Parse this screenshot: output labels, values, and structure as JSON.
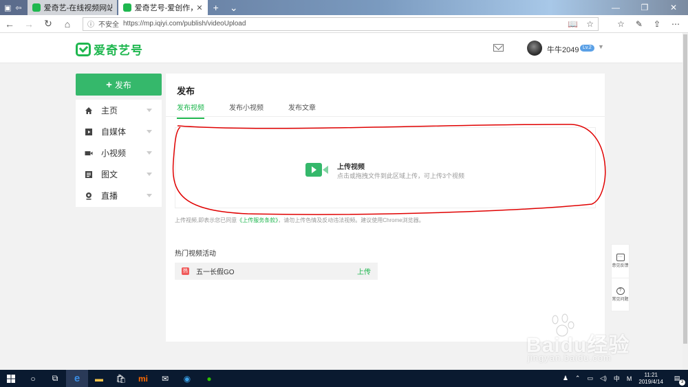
{
  "browser": {
    "tabs": [
      {
        "title": "爱奇艺-在线视频网站-海量正"
      },
      {
        "title": "爱奇艺号-爱创作，爱奇"
      }
    ],
    "new_tab_icon": "plus-icon",
    "address": {
      "security_label": "不安全",
      "url": "https://mp.iqiyi.com/publish/videoUpload"
    }
  },
  "site": {
    "logo_text": "爱奇艺号",
    "username": "牛牛2049",
    "level": "Lv.2"
  },
  "sidebar": {
    "publish_label": "发布",
    "items": [
      {
        "label": "主页",
        "icon": "home-icon"
      },
      {
        "label": "自媒体",
        "icon": "media-icon"
      },
      {
        "label": "小视频",
        "icon": "camera-icon"
      },
      {
        "label": "图文",
        "icon": "article-icon"
      },
      {
        "label": "直播",
        "icon": "live-icon"
      }
    ]
  },
  "main": {
    "title": "发布",
    "tabs": [
      {
        "label": "发布视频",
        "active": true
      },
      {
        "label": "发布小视频",
        "active": false
      },
      {
        "label": "发布文章",
        "active": false
      }
    ],
    "upload": {
      "title": "上传视频",
      "desc": "点击或拖拽文件到此区域上传，可上传3个视频"
    },
    "notice": {
      "before": "上传视频,即表示您已同意",
      "link": "《上传服务条款》",
      "after": "，请勿上传色情及反动违法视频。建议使用Chrome浏览器。"
    },
    "hot": {
      "title": "热门视频活动",
      "items": [
        {
          "badge": "热",
          "name": "五一长假GO",
          "action": "上传"
        }
      ]
    }
  },
  "float": {
    "feedback": "意见反馈",
    "faq": "常见问题"
  },
  "watermark": {
    "text": "Baidu经验",
    "sub": "jingyan.baidu.com"
  },
  "taskbar": {
    "ime": "中",
    "ime_mode": "M",
    "time": "11:21",
    "date": "2019/4/14",
    "notifications": "3"
  },
  "colors": {
    "brand_green": "#1fb74f",
    "button_green": "#35b86b",
    "annotation_red": "#e00000",
    "hot_badge": "#f05a5a"
  }
}
